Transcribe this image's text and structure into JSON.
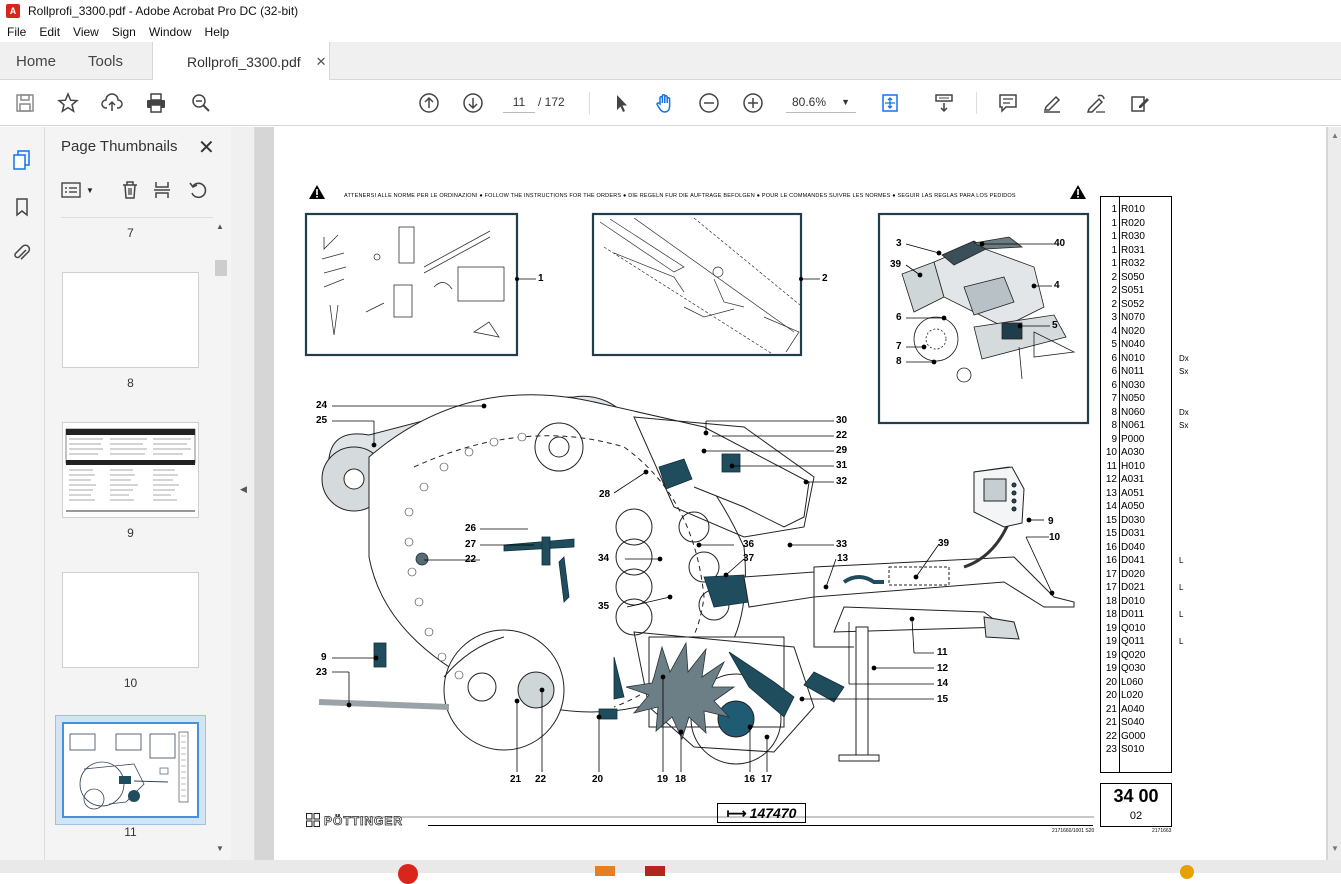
{
  "window": {
    "title": "Rollprofi_3300.pdf - Adobe Acrobat Pro DC (32-bit)"
  },
  "menubar": [
    "File",
    "Edit",
    "View",
    "Sign",
    "Window",
    "Help"
  ],
  "tabs": {
    "home": "Home",
    "tools": "Tools",
    "document": "Rollprofi_3300.pdf"
  },
  "toolbar": {
    "page_current": "11",
    "page_total": "/ 172",
    "zoom": "80.6%"
  },
  "thumbnails_panel": {
    "title": "Page Thumbnails",
    "pages": [
      {
        "label": "7"
      },
      {
        "label": "8"
      },
      {
        "label": "9"
      },
      {
        "label": "10"
      },
      {
        "label": "11"
      }
    ]
  },
  "document": {
    "header_notes": "ATTENERSI ALLE NORME PER LE ORDINAZIONI   ●   FOLLOW THE INSTRUCTIONS FOR THE ORDERS   ●   DIE REGELN FUR DIE AUFTRAGE BEFOLGEN   ●   POUR LE COMMANDES SUIVRE LES NORMES   ●   SEGUIR LAS REGLAS PARA LOS PEDIDOS",
    "callouts": {
      "c1": "1",
      "c2": "2",
      "c3": "3",
      "c39a": "39",
      "c40": "40",
      "c4": "4",
      "c6": "6",
      "c5": "5",
      "c7": "7",
      "c8": "8",
      "c24": "24",
      "c25": "25",
      "c30": "30",
      "c22a": "22",
      "c29": "29",
      "c31": "31",
      "c28": "28",
      "c32": "32",
      "c26": "26",
      "c27": "27",
      "c22b": "22",
      "c36": "36",
      "c33": "33",
      "c34": "34",
      "c37": "37",
      "c13": "13",
      "c39b": "39",
      "c9a": "9",
      "c10": "10",
      "c35": "35",
      "c11": "11",
      "c9b": "9",
      "c12": "12",
      "c23": "23",
      "c14": "14",
      "c15": "15",
      "c21": "21",
      "c22c": "22",
      "c20": "20",
      "c19": "19",
      "c18": "18",
      "c16": "16",
      "c17": "17"
    },
    "parts_list": [
      {
        "qty": "1",
        "code": "R010",
        "side": ""
      },
      {
        "qty": "1",
        "code": "R020",
        "side": ""
      },
      {
        "qty": "1",
        "code": "R030",
        "side": ""
      },
      {
        "qty": "1",
        "code": "R031",
        "side": ""
      },
      {
        "qty": "1",
        "code": "R032",
        "side": ""
      },
      {
        "qty": "2",
        "code": "S050",
        "side": ""
      },
      {
        "qty": "2",
        "code": "S051",
        "side": ""
      },
      {
        "qty": "2",
        "code": "S052",
        "side": ""
      },
      {
        "qty": "3",
        "code": "N070",
        "side": ""
      },
      {
        "qty": "4",
        "code": "N020",
        "side": ""
      },
      {
        "qty": "5",
        "code": "N040",
        "side": ""
      },
      {
        "qty": "6",
        "code": "N010",
        "side": "Dx"
      },
      {
        "qty": "6",
        "code": "N011",
        "side": "Sx"
      },
      {
        "qty": "6",
        "code": "N030",
        "side": ""
      },
      {
        "qty": "7",
        "code": "N050",
        "side": ""
      },
      {
        "qty": "8",
        "code": "N060",
        "side": "Dx"
      },
      {
        "qty": "8",
        "code": "N061",
        "side": "Sx"
      },
      {
        "qty": "9",
        "code": "P000",
        "side": ""
      },
      {
        "qty": "10",
        "code": "A030",
        "side": ""
      },
      {
        "qty": "11",
        "code": "H010",
        "side": ""
      },
      {
        "qty": "12",
        "code": "A031",
        "side": ""
      },
      {
        "qty": "13",
        "code": "A051",
        "side": ""
      },
      {
        "qty": "14",
        "code": "A050",
        "side": ""
      },
      {
        "qty": "15",
        "code": "D030",
        "side": ""
      },
      {
        "qty": "15",
        "code": "D031",
        "side": ""
      },
      {
        "qty": "16",
        "code": "D040",
        "side": ""
      },
      {
        "qty": "16",
        "code": "D041",
        "side": "L"
      },
      {
        "qty": "17",
        "code": "D020",
        "side": ""
      },
      {
        "qty": "17",
        "code": "D021",
        "side": "L"
      },
      {
        "qty": "18",
        "code": "D010",
        "side": ""
      },
      {
        "qty": "18",
        "code": "D011",
        "side": "L"
      },
      {
        "qty": "19",
        "code": "Q010",
        "side": ""
      },
      {
        "qty": "19",
        "code": "Q011",
        "side": "L"
      },
      {
        "qty": "19",
        "code": "Q020",
        "side": ""
      },
      {
        "qty": "19",
        "code": "Q030",
        "side": ""
      },
      {
        "qty": "20",
        "code": "L060",
        "side": ""
      },
      {
        "qty": "20",
        "code": "L020",
        "side": ""
      },
      {
        "qty": "21",
        "code": "A040",
        "side": ""
      },
      {
        "qty": "21",
        "code": "S040",
        "side": ""
      },
      {
        "qty": "22",
        "code": "G000",
        "side": ""
      },
      {
        "qty": "23",
        "code": "S010",
        "side": ""
      }
    ],
    "page_box": {
      "number": "34 00",
      "sub": "02"
    },
    "brand": "PÖTTINGER",
    "part_number": "147470",
    "footer_code": "2171660/1001  S20",
    "footer_code2": "2171663"
  }
}
